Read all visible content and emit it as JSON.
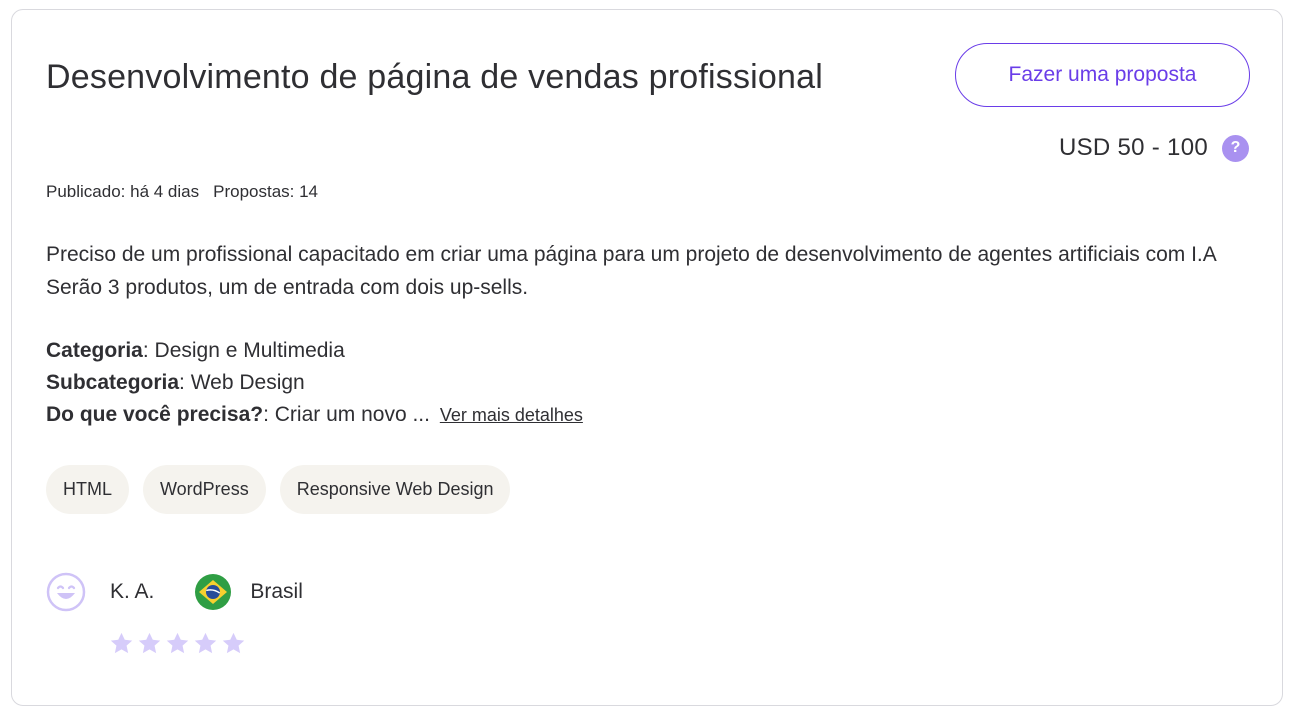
{
  "job": {
    "title": "Desenvolvimento de página de vendas profissional",
    "proposal_button": "Fazer uma proposta",
    "budget": "USD 50 - 100",
    "help_icon": "?",
    "published": "Publicado: há 4 dias",
    "proposals": "Propostas: 14",
    "description": "Preciso de um profissional capacitado em criar uma página para um projeto de  desenvolvimento de agentes artificiais com I.A  Serão 3 produtos, um de entrada com dois up-sells.",
    "details": {
      "category_label": "Categoria",
      "category_value": ": Design e Multimedia",
      "subcategory_label": "Subcategoria",
      "subcategory_value": ": Web Design",
      "need_label": "Do que você precisa?",
      "need_value": ": Criar um novo ...",
      "more_link": "Ver mais detalhes"
    },
    "tags": [
      "HTML",
      "WordPress",
      "Responsive Web Design"
    ]
  },
  "client": {
    "avatar_icon": "smiley-face-icon",
    "name": "K. A.",
    "flag_icon": "brazil-flag-icon",
    "country": "Brasil",
    "rating": 0,
    "rating_max": 5
  },
  "colors": {
    "accent": "#6a3de8",
    "help_icon": "#a991f0",
    "star": "#d6ccfa",
    "tag_bg": "#f5f3ee",
    "border": "#d9d9de"
  }
}
